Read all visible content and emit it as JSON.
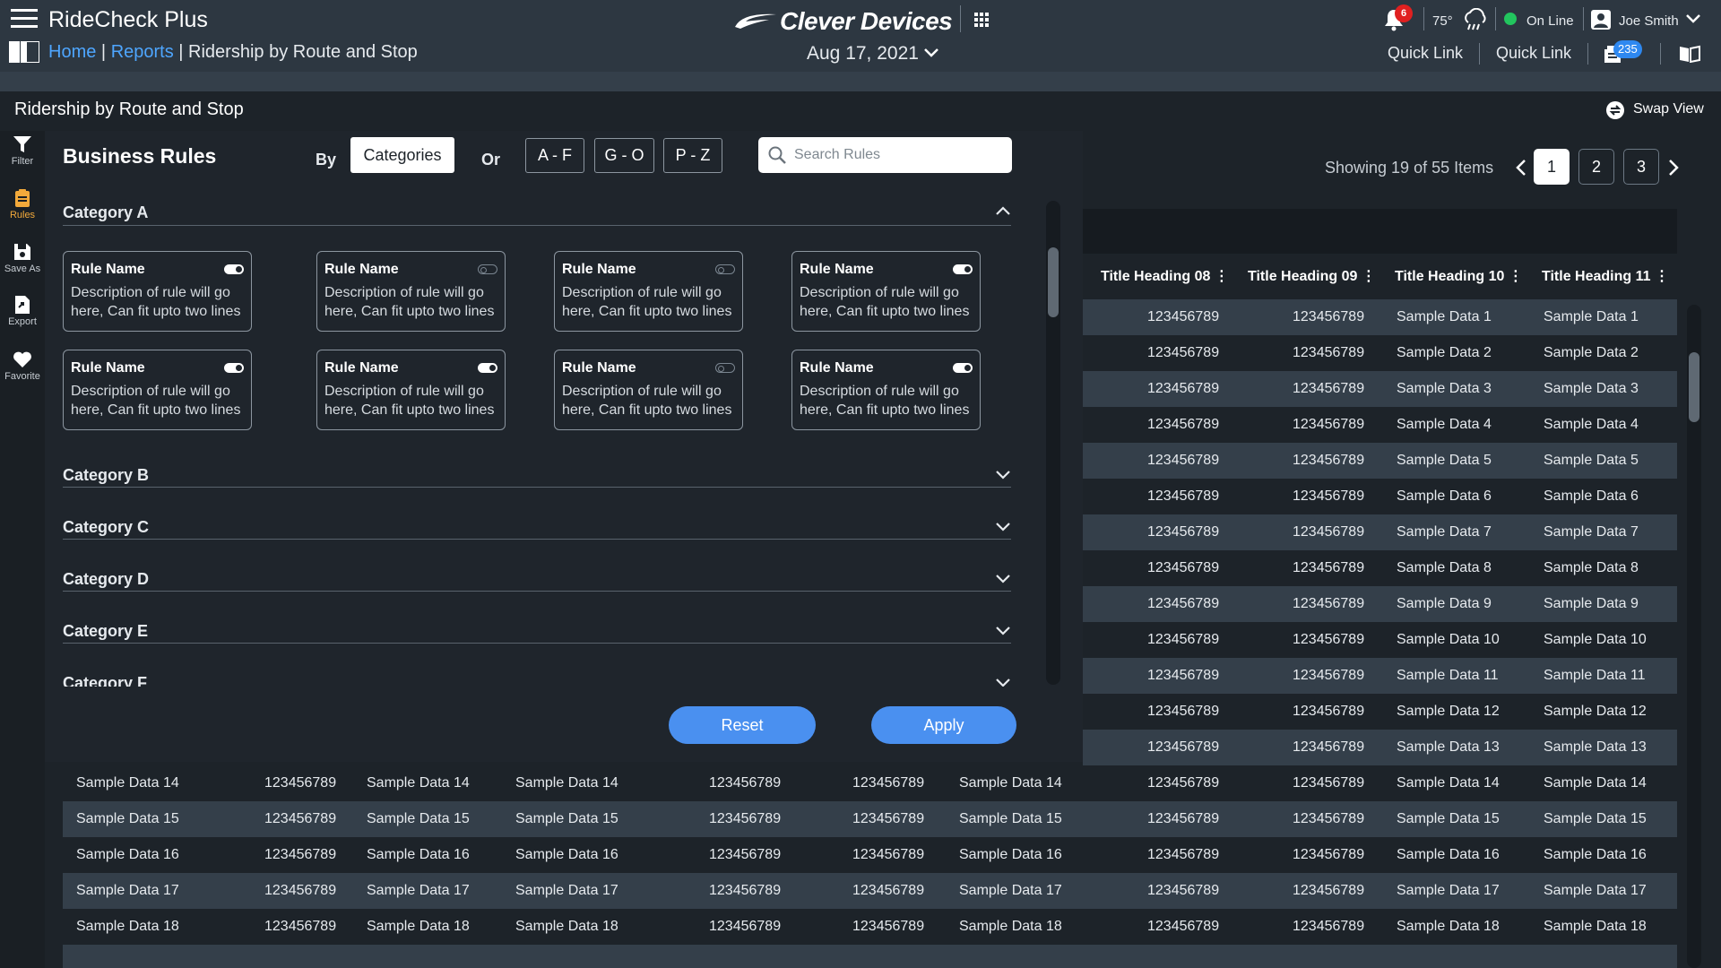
{
  "app": {
    "title": "RideCheck Plus",
    "brand": "Clever Devices"
  },
  "breadcrumb": {
    "home": "Home",
    "reports": "Reports",
    "current": "Ridership by Route and Stop",
    "separator": "|"
  },
  "header": {
    "date": "Aug 17, 2021",
    "notifications_count": "6",
    "temperature": "75°",
    "status": "On Line",
    "user": "Joe Smith",
    "quick_link_1": "Quick Link",
    "quick_link_2": "Quick Link",
    "messages_count": "235"
  },
  "page": {
    "title": "Ridership by Route and Stop",
    "swap_view": "Swap View"
  },
  "leftnav": [
    {
      "label": "Filter",
      "icon": "filter-icon"
    },
    {
      "label": "Rules",
      "icon": "clipboard-icon",
      "active": true
    },
    {
      "label": "Save As",
      "icon": "save-icon"
    },
    {
      "label": "Export",
      "icon": "export-icon"
    },
    {
      "label": "Favorite",
      "icon": "heart-icon"
    }
  ],
  "rules": {
    "title": "Business Rules",
    "by_label": "By",
    "or_label": "Or",
    "categories_button": "Categories",
    "ranges": [
      "A - F",
      "G - O",
      "P - Z"
    ],
    "search_placeholder": "Search Rules",
    "category_a": "Category A",
    "cards": [
      {
        "name": "Rule Name",
        "desc": "Description of rule will go here, Can fit upto two lines",
        "enabled": true
      },
      {
        "name": "Rule Name",
        "desc": "Description of rule will go here, Can fit upto two lines",
        "enabled": false
      },
      {
        "name": "Rule Name",
        "desc": "Description of rule will go here, Can fit upto two lines",
        "enabled": false
      },
      {
        "name": "Rule Name",
        "desc": "Description of rule will go here, Can fit upto two lines",
        "enabled": true
      },
      {
        "name": "Rule Name",
        "desc": "Description of rule will go here, Can fit upto two lines",
        "enabled": true
      },
      {
        "name": "Rule Name",
        "desc": "Description of rule will go here, Can fit upto two lines",
        "enabled": true
      },
      {
        "name": "Rule Name",
        "desc": "Description of rule will go here, Can fit upto two lines",
        "enabled": false
      },
      {
        "name": "Rule Name",
        "desc": "Description of rule will go here, Can fit upto two lines",
        "enabled": true
      }
    ],
    "collapsed_categories": [
      "Category B",
      "Category C",
      "Category D",
      "Category E",
      "Category F"
    ],
    "reset": "Reset",
    "apply": "Apply"
  },
  "table": {
    "showing": "Showing 19 of 55 Items",
    "pages": [
      "1",
      "2",
      "3"
    ],
    "active_page": "1",
    "headers": [
      "Title Heading 08",
      "Title Heading 09",
      "Title Heading 10",
      "Title Heading 11"
    ],
    "right_rows": [
      [
        "123456789",
        "123456789",
        "Sample Data 1",
        "Sample Data 1"
      ],
      [
        "123456789",
        "123456789",
        "Sample Data 2",
        "Sample Data 2"
      ],
      [
        "123456789",
        "123456789",
        "Sample Data 3",
        "Sample Data 3"
      ],
      [
        "123456789",
        "123456789",
        "Sample Data 4",
        "Sample Data 4"
      ],
      [
        "123456789",
        "123456789",
        "Sample Data 5",
        "Sample Data 5"
      ],
      [
        "123456789",
        "123456789",
        "Sample Data 6",
        "Sample Data 6"
      ],
      [
        "123456789",
        "123456789",
        "Sample Data 7",
        "Sample Data 7"
      ],
      [
        "123456789",
        "123456789",
        "Sample Data 8",
        "Sample Data 8"
      ],
      [
        "123456789",
        "123456789",
        "Sample Data 9",
        "Sample Data 9"
      ],
      [
        "123456789",
        "123456789",
        "Sample Data 10",
        "Sample Data 10"
      ],
      [
        "123456789",
        "123456789",
        "Sample Data 11",
        "Sample Data 11"
      ],
      [
        "123456789",
        "123456789",
        "Sample Data 12",
        "Sample Data 12"
      ],
      [
        "123456789",
        "123456789",
        "Sample Data 13",
        "Sample Data 13"
      ]
    ],
    "full_rows": [
      [
        "Sample Data 14",
        "123456789",
        "Sample Data 14",
        "Sample Data 14",
        "123456789",
        "123456789",
        "Sample Data 14",
        "123456789",
        "123456789",
        "Sample Data 14",
        "Sample Data 14"
      ],
      [
        "Sample Data 15",
        "123456789",
        "Sample Data 15",
        "Sample Data 15",
        "123456789",
        "123456789",
        "Sample Data 15",
        "123456789",
        "123456789",
        "Sample Data 15",
        "Sample Data 15"
      ],
      [
        "Sample Data 16",
        "123456789",
        "Sample Data 16",
        "Sample Data 16",
        "123456789",
        "123456789",
        "Sample Data 16",
        "123456789",
        "123456789",
        "Sample Data 16",
        "Sample Data 16"
      ],
      [
        "Sample Data 17",
        "123456789",
        "Sample Data 17",
        "Sample Data 17",
        "123456789",
        "123456789",
        "Sample Data 17",
        "123456789",
        "123456789",
        "Sample Data 17",
        "Sample Data 17"
      ],
      [
        "Sample Data 18",
        "123456789",
        "Sample Data 18",
        "Sample Data 18",
        "123456789",
        "123456789",
        "Sample Data 18",
        "123456789",
        "123456789",
        "Sample Data 18",
        "Sample Data 18"
      ]
    ]
  },
  "colors": {
    "accent": "#4a90f0",
    "link": "#4ea6ff",
    "active_nav": "#f2a93b",
    "online": "#22c55e",
    "alert": "#e02020"
  }
}
